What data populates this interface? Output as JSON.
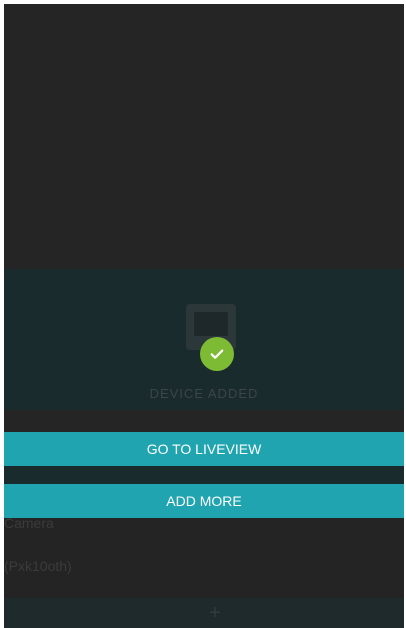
{
  "status_overlay": {
    "device_label": "DEVICE ADDED"
  },
  "actions": {
    "go_to_liveview": "GO TO LIVEVIEW",
    "add_more": "ADD MORE"
  },
  "background_list": {
    "line_1": "Camera",
    "line_2": "(Pxk10oth)"
  },
  "icons": {
    "device": "camera-device-icon",
    "check": "checkmark-icon",
    "add": "plus-icon"
  },
  "colors": {
    "accent": "#1fa4b0",
    "success": "#7dbb35"
  }
}
